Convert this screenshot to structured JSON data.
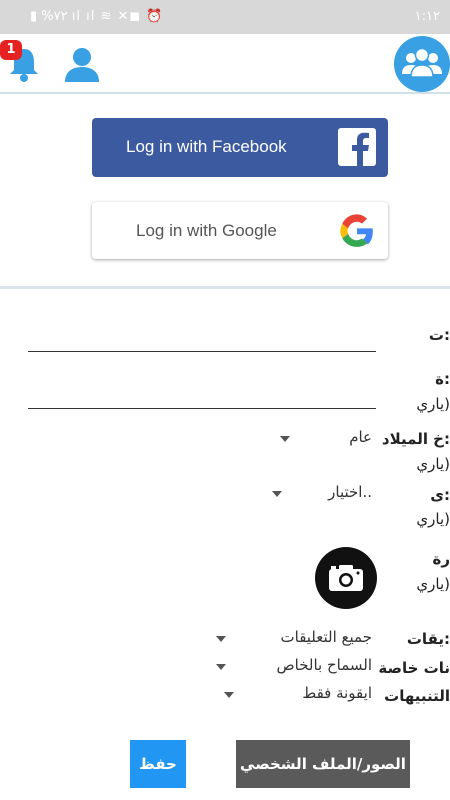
{
  "status_bar": {
    "left_text": "▮ %٧٢ ıl ıl ≋ ✕◼ ⏰",
    "time": "١:١٢"
  },
  "header": {
    "notification_count": "1",
    "icons": [
      "bell-icon",
      "user-icon",
      "groups-icon"
    ],
    "accent_color": "#3aa0e4"
  },
  "social": {
    "facebook_label": "Log in with Facebook",
    "google_label": "Log in with Google",
    "facebook_color": "#3b5a9f"
  },
  "form": {
    "field1_label": "ت:",
    "field2_label": "ة:",
    "field2_note": "ياري)",
    "birth_label": "خ الميلاد:",
    "birth_note": "ياري)",
    "birth_year_value": "عام",
    "gender_label": "ى:",
    "gender_note": "ياري)",
    "gender_value": "اختيار..",
    "photo_label": "رة",
    "photo_note": "ياري)",
    "comments_label": "يقات:",
    "comments_value": "جميع التعليقات",
    "private_label": "نات خاصة",
    "private_value": "السماح بالخاص",
    "notify_label": "التنبيهات",
    "notify_value": "ايقونة فقط"
  },
  "buttons": {
    "save_label": "حفظ",
    "photos_label": "الصور/الملف الشخصي"
  }
}
